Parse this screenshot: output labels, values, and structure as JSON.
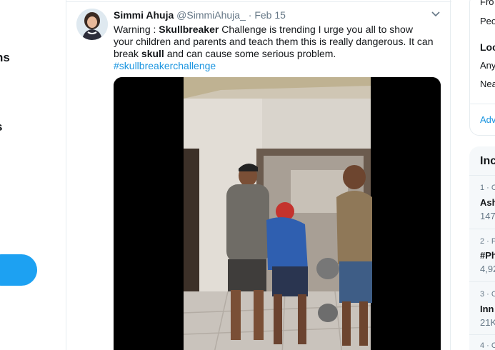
{
  "left_nav": {
    "items": [
      {
        "label": "ns"
      },
      {
        "label": "s"
      }
    ]
  },
  "tweet": {
    "name": "Simmi Ahuja",
    "handle": "@SimmiAhuja_",
    "separator": "·",
    "date": "Feb 15",
    "text_prefix": "Warning : ",
    "text_bold1": "Skullbreaker",
    "text_mid": " Challenge is trending I urge you all to show your children and parents and teach them this is really dangerous. It can break ",
    "text_bold2": "skull",
    "text_suffix": " and can cause some serious problem.",
    "hashtag": "#skullbreakerchallenge"
  },
  "right_column": {
    "settings": {
      "from_label": "Fro",
      "people_label": "Peo",
      "location_heading": "Loc",
      "location_any": "Any",
      "location_near": "Nea",
      "advanced_link": "Adv"
    },
    "trends": {
      "heading": "Inc",
      "items": [
        {
          "rank_meta": "1 · C",
          "title": "Ash",
          "count": "147"
        },
        {
          "rank_meta": "2 · P",
          "title": "#Ph",
          "count": "4,92"
        },
        {
          "rank_meta": "3 · C",
          "title": "Inn",
          "count": "21K"
        },
        {
          "rank_meta": "4 · C",
          "title": "",
          "count": ""
        }
      ]
    }
  },
  "colors": {
    "accent": "#1da1f2",
    "link": "#1b95e0",
    "secondary_text": "#657786",
    "border": "#e6ecf0"
  }
}
